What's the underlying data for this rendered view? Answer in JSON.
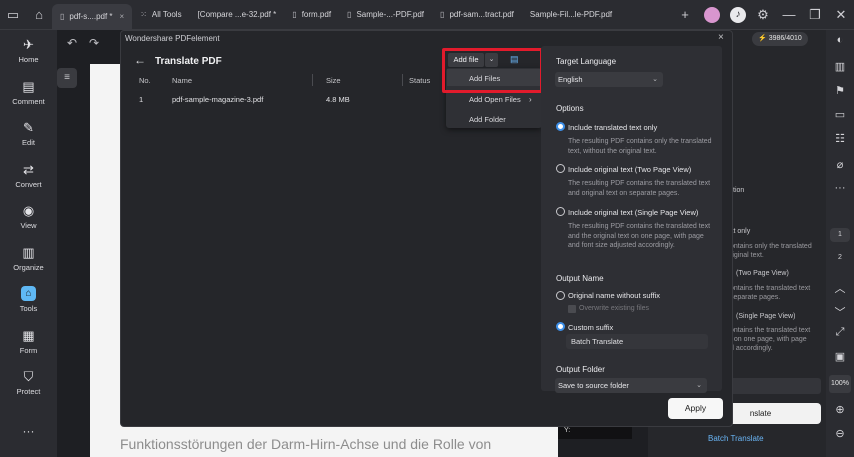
{
  "titlebar": {
    "tabs": [
      {
        "label": "pdf-s....pdf *",
        "active": true
      },
      {
        "label": "All Tools",
        "icon": "grid-icon"
      },
      {
        "label": "[Compare ...e-32.pdf *"
      },
      {
        "label": "form.pdf"
      },
      {
        "label": "Sample-...-PDF.pdf"
      },
      {
        "label": "pdf-sam...tract.pdf"
      },
      {
        "label": "Sample-Fil...le-PDF.pdf"
      }
    ],
    "close_glyph": "×",
    "add_glyph": "+"
  },
  "left_nav": [
    {
      "label": "Home",
      "icon": "rocket-icon",
      "glyph": "✈"
    },
    {
      "label": "Comment",
      "icon": "comment-icon",
      "glyph": "▤"
    },
    {
      "label": "Edit",
      "icon": "edit-icon",
      "glyph": "✎"
    },
    {
      "label": "Convert",
      "icon": "convert-icon",
      "glyph": "⇄"
    },
    {
      "label": "View",
      "icon": "eye-icon",
      "glyph": "◉"
    },
    {
      "label": "Organize",
      "icon": "organize-icon",
      "glyph": "▥"
    },
    {
      "label": "Tools",
      "icon": "tools-icon",
      "glyph": "⌂",
      "active": true
    },
    {
      "label": "Form",
      "icon": "form-icon",
      "glyph": "▦"
    },
    {
      "label": "Protect",
      "icon": "shield-icon",
      "glyph": "⛉"
    }
  ],
  "document": {
    "bottom_text": "Funktionsstörungen der Darm-Hirn-Achse und die Rolle von",
    "note_text": "Y:"
  },
  "right_panel": {
    "credits": "3986/4010",
    "lines": [
      {
        "text": "xt only",
        "dim": false
      },
      {
        "text": "ontains only the translated",
        "dim": true
      },
      {
        "text": "riginal text.",
        "dim": true
      },
      {
        "text": "(Two Page View)",
        "dim": false
      },
      {
        "text": "ontains the translated text",
        "dim": true
      },
      {
        "text": "separate pages.",
        "dim": true
      },
      {
        "text": "(Single Page View)",
        "dim": false
      },
      {
        "text": "ontains the translated text",
        "dim": true
      },
      {
        "text": "t on one page, with page",
        "dim": true
      },
      {
        "text": "d accordingly.",
        "dim": true
      },
      {
        "text": "tion",
        "dim": false
      }
    ],
    "translate_button": "nslate",
    "batch_link": "Batch Translate"
  },
  "right_bar": {
    "pages": [
      "1",
      "2"
    ],
    "zoom": "100%"
  },
  "dialog": {
    "app_name": "Wondershare PDFelement",
    "title": "Translate PDF",
    "columns": {
      "no": "No.",
      "name": "Name",
      "size": "Size",
      "status": "Status"
    },
    "rows": [
      {
        "no": "1",
        "name": "pdf-sample-magazine-3.pdf",
        "size": "4.8 MB"
      }
    ],
    "add_file_button": "Add file",
    "caret_glyph": "⌄",
    "menu": {
      "items": [
        "Add Files",
        "Add Open Files",
        "Add Folder"
      ],
      "submenu_arrow": "›"
    },
    "options": {
      "target_language_heading": "Target Language",
      "target_language_value": "English",
      "options_heading": "Options",
      "radio_options": [
        {
          "label": "Include translated text only",
          "desc": "The resulting PDF contains only the translated text, without the original text.",
          "selected": true
        },
        {
          "label": "Include original text (Two Page View)",
          "desc": "The resulting PDF contains the translated text and original text on separate pages.",
          "selected": false
        },
        {
          "label": "Include original text (Single Page View)",
          "desc": "The resulting PDF contains the translated text and the original text on one page, with page and font size adjusted accordingly.",
          "selected": false
        }
      ],
      "output_name_heading": "Output Name",
      "name_options": [
        {
          "label": "Original name without suffix",
          "selected": false
        },
        {
          "label": "Custom suffix",
          "selected": true
        }
      ],
      "overwrite_label": "Overwrite existing files",
      "suffix_value": "Batch Translate",
      "output_folder_heading": "Output Folder",
      "output_folder_value": "Save to source folder"
    },
    "apply_button": "Apply"
  },
  "colors": {
    "accent": "#3d8fe8",
    "highlight_border": "#e21b2c",
    "link": "#6ab5f5"
  }
}
